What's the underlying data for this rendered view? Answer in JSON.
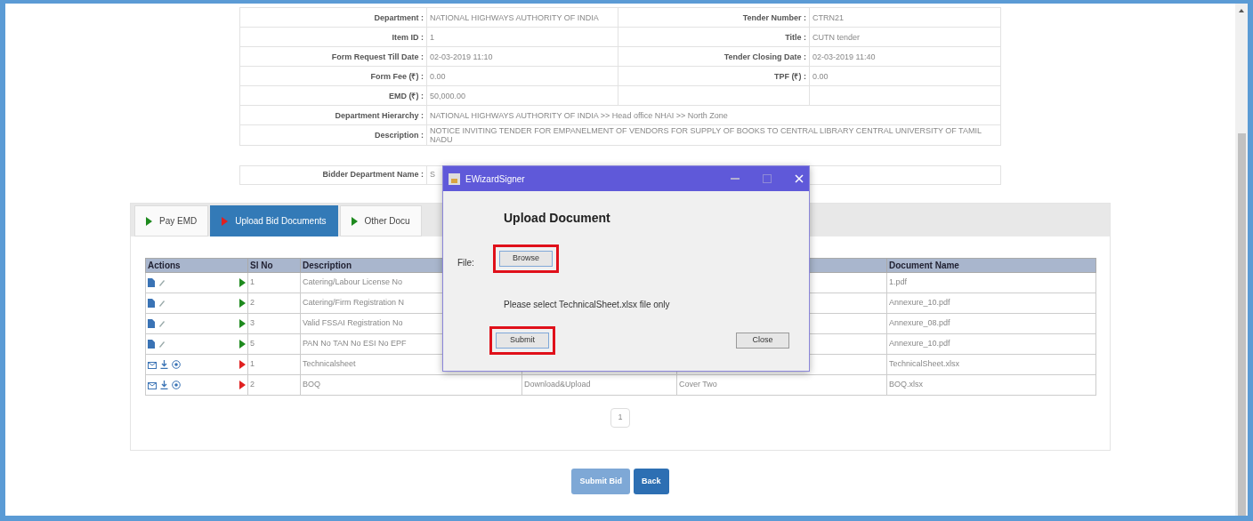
{
  "tender_info": {
    "rows": [
      {
        "kind": "pair",
        "left_label": "Department :",
        "left_value": "NATIONAL HIGHWAYS AUTHORITY OF INDIA",
        "right_label": "Tender Number :",
        "right_value": "CTRN21"
      },
      {
        "kind": "pair",
        "left_label": "Item ID :",
        "left_value": "1",
        "right_label": "Title :",
        "right_value": "CUTN tender"
      },
      {
        "kind": "pair",
        "left_label": "Form Request Till Date :",
        "left_value": "02-03-2019 11:10",
        "right_label": "Tender Closing Date :",
        "right_value": "02-03-2019 11:40"
      },
      {
        "kind": "pair",
        "left_label": "Form Fee (₹) :",
        "left_value": "0.00",
        "right_label": "TPF (₹) :",
        "right_value": "0.00"
      },
      {
        "kind": "pair",
        "left_label": "EMD (₹) :",
        "left_value": "50,000.00"
      },
      {
        "kind": "wide",
        "left_label": "Department Hierarchy :",
        "left_value": "NATIONAL HIGHWAYS AUTHORITY OF INDIA >> Head office NHAI >> North Zone"
      },
      {
        "kind": "wide",
        "left_label": "Description :",
        "left_value": "NOTICE INVITING TENDER FOR EMPANELMENT OF VENDORS FOR SUPPLY OF BOOKS TO CENTRAL LIBRARY CENTRAL UNIVERSITY OF TAMIL NADU"
      }
    ]
  },
  "bidder": {
    "label": "Bidder Department Name :",
    "value": "S"
  },
  "tabs": [
    {
      "label": "Pay EMD",
      "selected": false,
      "color": "#1e8a1e"
    },
    {
      "label": "Upload Bid Documents",
      "selected": true,
      "color": "#e02020"
    },
    {
      "label": "Other Docu",
      "selected": false,
      "color": "#1e8a1e"
    }
  ],
  "documents": {
    "columns": [
      "Actions",
      "Sl No",
      "Description",
      "Document Name"
    ],
    "rows": [
      {
        "kind": "file",
        "color": "#1e8a1e",
        "sl_no": "1",
        "description": "Catering/Labour License No",
        "document_name": "1.pdf"
      },
      {
        "kind": "file",
        "color": "#1e8a1e",
        "sl_no": "2",
        "description": "Catering/Firm Registration N",
        "document_name": "Annexure_10.pdf"
      },
      {
        "kind": "file",
        "color": "#1e8a1e",
        "sl_no": "3",
        "description": "Valid FSSAI Registration No",
        "document_name": "Annexure_08.pdf"
      },
      {
        "kind": "file",
        "color": "#1e8a1e",
        "sl_no": "5",
        "description": "PAN No TAN No ESI No EPF",
        "document_name": "Annexure_10.pdf"
      },
      {
        "kind": "sheet",
        "color": "#e02020",
        "sl_no": "1",
        "description": "Technicalsheet",
        "document_name": "TechnicalSheet.xlsx"
      },
      {
        "kind": "sheet",
        "color": "#e02020",
        "sl_no": "2",
        "description": "BOQ",
        "column_4": "Download&Upload",
        "column_5": "Cover Two",
        "document_name": "BOQ.xlsx"
      }
    ],
    "pages": [
      {
        "label": "1",
        "selected": true
      }
    ]
  },
  "buttons": [
    {
      "label": "Submit Bid",
      "disabled": true
    },
    {
      "label": "Back",
      "disabled": false
    }
  ],
  "dialog": {
    "title": "EWizardSigner",
    "heading": "Upload Document",
    "file_label": "File:",
    "browse": {
      "label": "Browse",
      "highlighted": true
    },
    "message": "Please select TechnicalSheet.xlsx file only",
    "submit": {
      "label": "Submit",
      "highlighted": true
    },
    "close": {
      "label": "Close"
    }
  }
}
